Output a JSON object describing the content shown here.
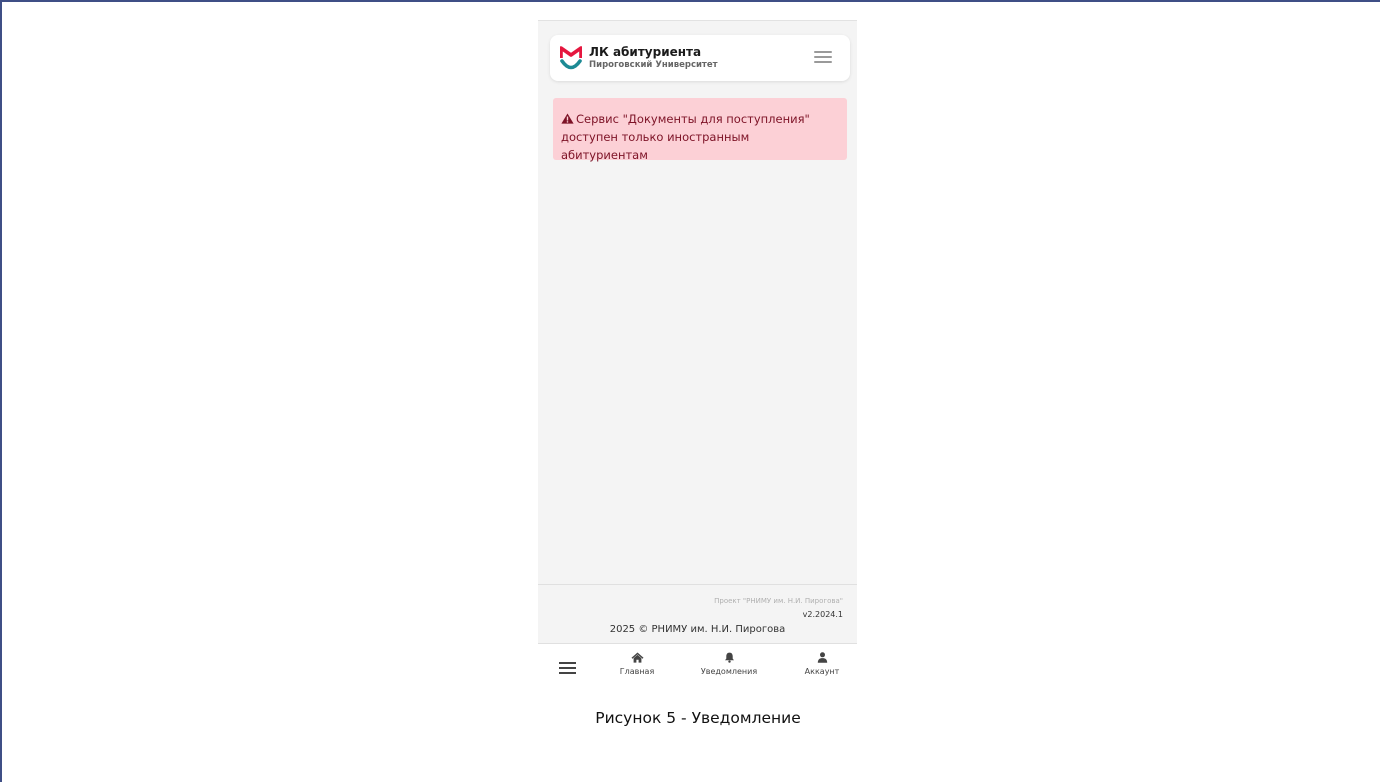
{
  "header": {
    "title": "ЛК абитуриента",
    "subtitle": "Пироговский Университет",
    "logo_icon": "university-logo-icon",
    "menu_icon": "hamburger-menu-icon"
  },
  "alert": {
    "icon": "warning-triangle-icon",
    "text": "Сервис \"Документы для поступления\" доступен только иностранным абитуриентам",
    "color": "#7d1226",
    "background": "#fcd0d6"
  },
  "footer": {
    "project": "Проект \"РНИМУ им. Н.И. Пирогова\"",
    "version": "v2.2024.1",
    "copyright": "2025 © РНИМУ им. Н.И. Пирогова"
  },
  "bottom_nav": {
    "menu_icon": "hamburger-menu-icon",
    "items": [
      {
        "label": "Главная",
        "icon": "home-icon"
      },
      {
        "label": "Уведомления",
        "icon": "bell-icon"
      },
      {
        "label": "Аккаунт",
        "icon": "user-icon"
      }
    ]
  },
  "caption": "Рисунок 5 - Уведомление",
  "colors": {
    "brand_red": "#e5173f",
    "brand_teal": "#1c8a94"
  }
}
